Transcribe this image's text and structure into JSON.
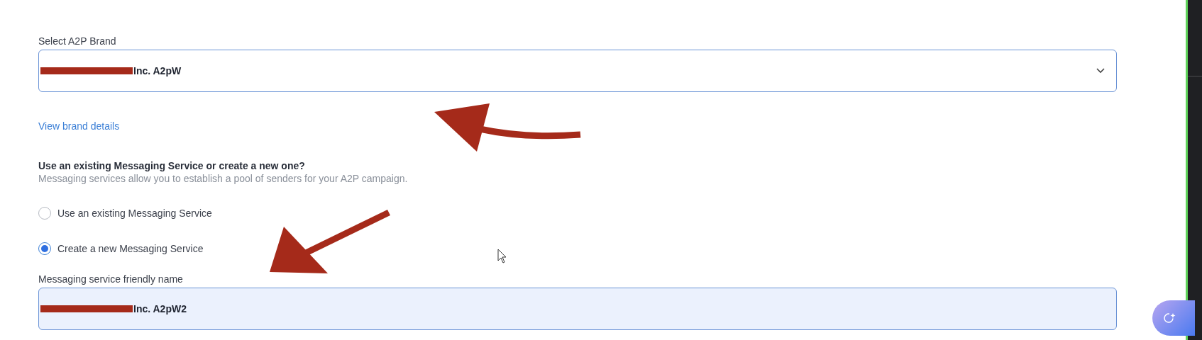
{
  "brand_select": {
    "label": "Select A2P Brand",
    "value": "Inc. A2pW"
  },
  "brand_link": "View brand details",
  "messaging_service": {
    "question": "Use an existing Messaging Service or create a new one?",
    "description": "Messaging services allow you to establish a pool of senders for your A2P campaign.",
    "options": [
      {
        "label": "Use an existing Messaging Service",
        "selected": false
      },
      {
        "label": "Create a new Messaging Service",
        "selected": true
      }
    ]
  },
  "friendly_name": {
    "label": "Messaging service friendly name",
    "value": "Inc. A2pW2"
  }
}
